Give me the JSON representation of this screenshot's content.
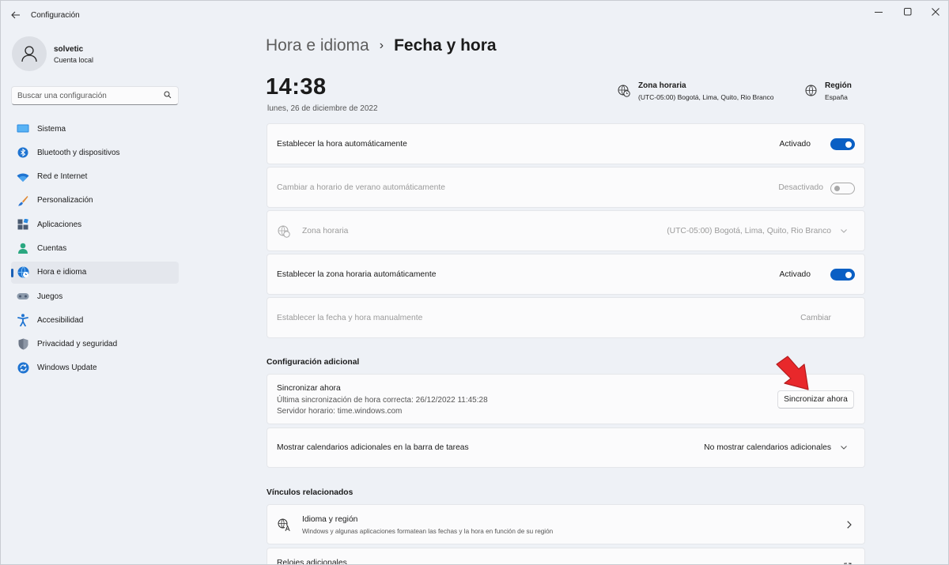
{
  "window": {
    "title": "Configuración"
  },
  "profile": {
    "name": "solvetic",
    "account_type": "Cuenta local"
  },
  "search": {
    "placeholder": "Buscar una configuración"
  },
  "sidebar": {
    "items": [
      {
        "label": "Sistema",
        "icon": "monitor-icon"
      },
      {
        "label": "Bluetooth y dispositivos",
        "icon": "bluetooth-icon"
      },
      {
        "label": "Red e Internet",
        "icon": "wifi-icon"
      },
      {
        "label": "Personalización",
        "icon": "brush-icon"
      },
      {
        "label": "Aplicaciones",
        "icon": "apps-icon"
      },
      {
        "label": "Cuentas",
        "icon": "person-icon"
      },
      {
        "label": "Hora e idioma",
        "icon": "globe-clock-icon",
        "active": true
      },
      {
        "label": "Juegos",
        "icon": "gamepad-icon"
      },
      {
        "label": "Accesibilidad",
        "icon": "accessibility-icon"
      },
      {
        "label": "Privacidad y seguridad",
        "icon": "shield-icon"
      },
      {
        "label": "Windows Update",
        "icon": "update-icon"
      }
    ]
  },
  "breadcrumb": {
    "parent": "Hora e idioma",
    "separator": "›",
    "current": "Fecha y hora"
  },
  "clock": {
    "time": "14:38",
    "date": "lunes, 26 de diciembre de 2022"
  },
  "header_info": {
    "timezone": {
      "title": "Zona horaria",
      "value": "(UTC-05:00) Bogotá, Lima, Quito, Rio Branco"
    },
    "region": {
      "title": "Región",
      "value": "España"
    }
  },
  "settings": {
    "auto_time": {
      "label": "Establecer la hora automáticamente",
      "state": "Activado",
      "on": true
    },
    "dst": {
      "label": "Cambiar a horario de verano automáticamente",
      "state": "Desactivado",
      "on": false
    },
    "timezone": {
      "label": "Zona horaria",
      "value": "(UTC-05:00) Bogotá, Lima, Quito, Rio Branco"
    },
    "auto_timezone": {
      "label": "Establecer la zona horaria automáticamente",
      "state": "Activado",
      "on": true
    },
    "manual": {
      "label": "Establecer la fecha y hora manualmente",
      "button": "Cambiar"
    }
  },
  "additional": {
    "title": "Configuración adicional",
    "sync": {
      "label": "Sincronizar ahora",
      "last_sync": "Última sincronización de hora correcta: 26/12/2022 11:45:28",
      "server": "Servidor horario: time.windows.com",
      "button": "Sincronizar ahora"
    },
    "calendars": {
      "label": "Mostrar calendarios adicionales en la barra de tareas",
      "value": "No mostrar calendarios adicionales"
    }
  },
  "related": {
    "title": "Vínculos relacionados",
    "language_region": {
      "label": "Idioma y región",
      "description": "Windows y algunas aplicaciones formatean las fechas y la hora en función de su región"
    },
    "clocks": {
      "label": "Relojes adicionales"
    }
  },
  "colors": {
    "accent": "#0a5fc4",
    "annotation_arrow": "#e8282b"
  }
}
